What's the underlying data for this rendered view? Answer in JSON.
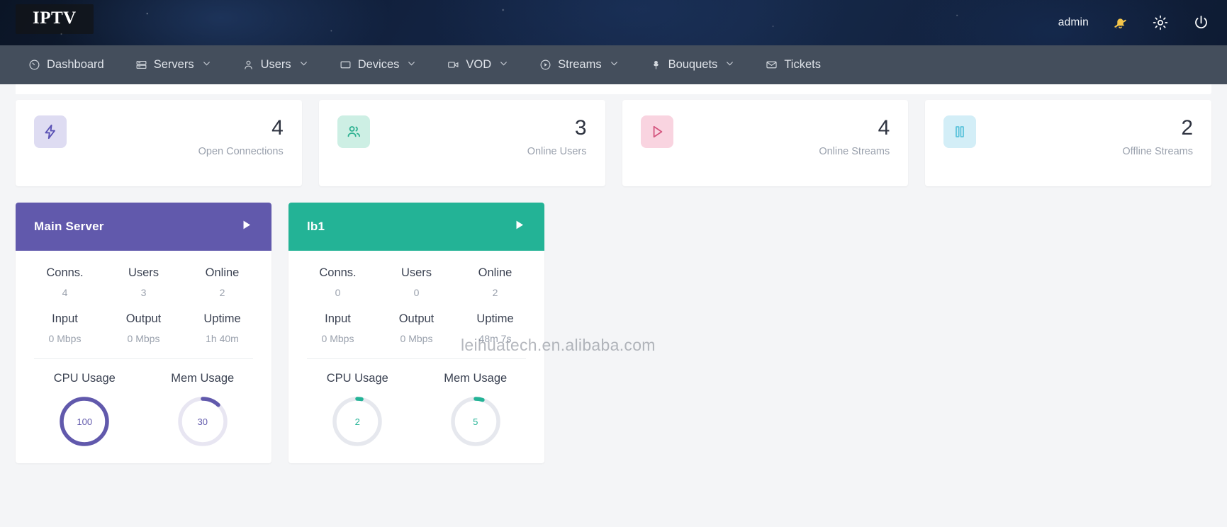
{
  "header": {
    "logo": "IPTV",
    "user": "admin",
    "icons": {
      "bell_slash": "bell-slash-icon",
      "gear": "gear-icon",
      "power": "power-icon"
    }
  },
  "nav": {
    "items": [
      {
        "label": "Dashboard",
        "icon": "gauge-icon",
        "caret": false
      },
      {
        "label": "Servers",
        "icon": "server-icon",
        "caret": true
      },
      {
        "label": "Users",
        "icon": "user-icon",
        "caret": true
      },
      {
        "label": "Devices",
        "icon": "monitor-icon",
        "caret": true
      },
      {
        "label": "VOD",
        "icon": "video-camera-icon",
        "caret": true
      },
      {
        "label": "Streams",
        "icon": "play-circle-icon",
        "caret": true
      },
      {
        "label": "Bouquets",
        "icon": "flower-icon",
        "caret": true
      },
      {
        "label": "Tickets",
        "icon": "envelope-icon",
        "caret": false
      }
    ]
  },
  "stats": [
    {
      "value": "4",
      "label": "Open Connections",
      "icon": "lightning-bolt-icon",
      "color": "#5b53b5",
      "bg": "#dedcf2"
    },
    {
      "value": "3",
      "label": "Online Users",
      "icon": "users-icon",
      "color": "#2eb191",
      "bg": "#cdefe4"
    },
    {
      "value": "4",
      "label": "Online Streams",
      "icon": "play-icon",
      "color": "#d4567f",
      "bg": "#f9d4e0"
    },
    {
      "value": "2",
      "label": "Offline Streams",
      "icon": "pause-icon",
      "color": "#5cc3db",
      "bg": "#d3eef7"
    }
  ],
  "servers": [
    {
      "name": "Main Server",
      "accent": "#6159ac",
      "stats_top": [
        {
          "key": "Conns.",
          "value": "4"
        },
        {
          "key": "Users",
          "value": "3"
        },
        {
          "key": "Online",
          "value": "2"
        }
      ],
      "stats_bottom": [
        {
          "key": "Input",
          "value": "0 Mbps"
        },
        {
          "key": "Output",
          "value": "0 Mbps"
        },
        {
          "key": "Uptime",
          "value": "1h 40m"
        }
      ],
      "gauges": [
        {
          "label": "CPU Usage",
          "value": "100",
          "percent": 100
        },
        {
          "label": "Mem Usage",
          "value": "30",
          "percent": 12
        }
      ]
    },
    {
      "name": "lb1",
      "accent": "#23b396",
      "stats_top": [
        {
          "key": "Conns.",
          "value": "0"
        },
        {
          "key": "Users",
          "value": "0"
        },
        {
          "key": "Online",
          "value": "2"
        }
      ],
      "stats_bottom": [
        {
          "key": "Input",
          "value": "0 Mbps"
        },
        {
          "key": "Output",
          "value": "0 Mbps"
        },
        {
          "key": "Uptime",
          "value": "48m 7s"
        }
      ],
      "gauges": [
        {
          "label": "CPU Usage",
          "value": "2",
          "percent": 3
        },
        {
          "label": "Mem Usage",
          "value": "5",
          "percent": 5
        }
      ]
    }
  ],
  "watermark": "leihuatech.en.alibaba.com"
}
